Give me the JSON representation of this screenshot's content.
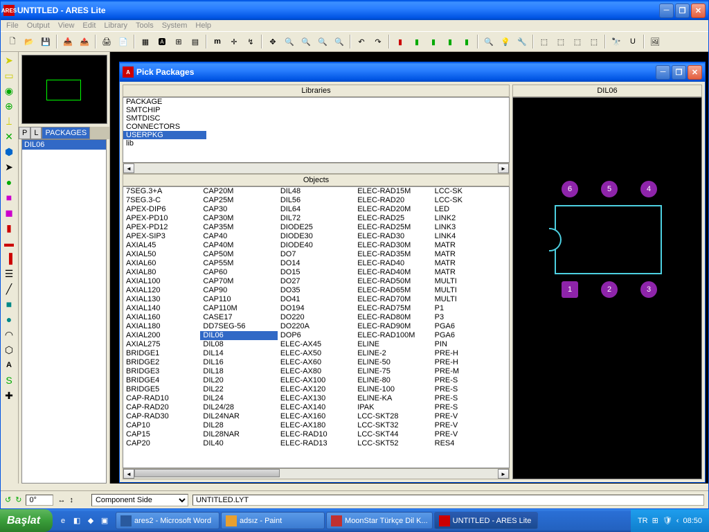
{
  "window": {
    "title": "UNTITLED - ARES Lite",
    "icon_text": "ARES"
  },
  "menu": [
    "File",
    "Output",
    "View",
    "Edit",
    "Library",
    "Tools",
    "System",
    "Help"
  ],
  "left_panel": {
    "tabs": [
      "P",
      "L",
      "PACKAGES"
    ],
    "items": [
      "DIL06"
    ]
  },
  "dialog": {
    "title": "Pick Packages",
    "libraries_header": "Libraries",
    "objects_header": "Objects",
    "preview_header": "DIL06",
    "libraries": [
      "PACKAGE",
      "SMTCHIP",
      "SMTDISC",
      "CONNECTORS",
      "USERPKG",
      "lib"
    ],
    "selected_library": "USERPKG",
    "selected_object": "DIL06",
    "columns": [
      [
        "7SEG.3+A",
        "7SEG.3-C",
        "APEX-DIP6",
        "APEX-PD10",
        "APEX-PD12",
        "APEX-SIP3",
        "AXIAL45",
        "AXIAL50",
        "AXIAL60",
        "AXIAL80",
        "AXIAL100",
        "AXIAL120",
        "AXIAL130",
        "AXIAL140",
        "AXIAL160",
        "AXIAL180",
        "AXIAL200",
        "AXIAL275",
        "BRIDGE1",
        "BRIDGE2",
        "BRIDGE3",
        "BRIDGE4",
        "BRIDGE5",
        "CAP-RAD10",
        "CAP-RAD20",
        "CAP-RAD30",
        "CAP10",
        "CAP15",
        "CAP20"
      ],
      [
        "CAP20M",
        "CAP25M",
        "CAP30",
        "CAP30M",
        "CAP35M",
        "CAP40",
        "CAP40M",
        "CAP50M",
        "CAP55M",
        "CAP60",
        "CAP70M",
        "CAP90",
        "CAP110",
        "CAP110M",
        "CASE17",
        "DD7SEG-56",
        "DIL06",
        "DIL08",
        "DIL14",
        "DIL16",
        "DIL18",
        "DIL20",
        "DIL22",
        "DIL24",
        "DIL24/28",
        "DIL24NAR",
        "DIL28",
        "DIL28NAR",
        "DIL40"
      ],
      [
        "DIL48",
        "DIL56",
        "DIL64",
        "DIL72",
        "DIODE25",
        "DIODE30",
        "DIODE40",
        "DO7",
        "DO14",
        "DO15",
        "DO27",
        "DO35",
        "DO41",
        "DO194",
        "DO220",
        "DO220A",
        "DOP6",
        "ELEC-AX45",
        "ELEC-AX50",
        "ELEC-AX60",
        "ELEC-AX80",
        "ELEC-AX100",
        "ELEC-AX120",
        "ELEC-AX130",
        "ELEC-AX140",
        "ELEC-AX160",
        "ELEC-AX180",
        "ELEC-RAD10",
        "ELEC-RAD13"
      ],
      [
        "ELEC-RAD15M",
        "ELEC-RAD20",
        "ELEC-RAD20M",
        "ELEC-RAD25",
        "ELEC-RAD25M",
        "ELEC-RAD30",
        "ELEC-RAD30M",
        "ELEC-RAD35M",
        "ELEC-RAD40",
        "ELEC-RAD40M",
        "ELEC-RAD50M",
        "ELEC-RAD65M",
        "ELEC-RAD70M",
        "ELEC-RAD75M",
        "ELEC-RAD80M",
        "ELEC-RAD90M",
        "ELEC-RAD100M",
        "ELINE",
        "ELINE-2",
        "ELINE-50",
        "ELINE-75",
        "ELINE-80",
        "ELINE-100",
        "ELINE-KA",
        "IPAK",
        "LCC-SKT28",
        "LCC-SKT32",
        "LCC-SKT44",
        "LCC-SKT52"
      ],
      [
        "LCC-SK",
        "LCC-SK",
        "LED",
        "LINK2",
        "LINK3",
        "LINK4",
        "MATR",
        "MATR",
        "MATR",
        "MATR",
        "MULTI",
        "MULTI",
        "MULTI",
        "P1",
        "P3",
        "PGA6",
        "PGA6",
        "PIN",
        "PRE-H",
        "PRE-H",
        "PRE-M",
        "PRE-S",
        "PRE-S",
        "PRE-S",
        "PRE-S",
        "PRE-V",
        "PRE-V",
        "PRE-V",
        "RES4"
      ]
    ],
    "pads": [
      "6",
      "5",
      "4",
      "1",
      "2",
      "3"
    ]
  },
  "statusbar": {
    "rotation": "0°",
    "layer": "Component Side",
    "file": "UNTITLED.LYT"
  },
  "taskbar": {
    "start": "Başlat",
    "tasks": [
      {
        "label": "ares2 - Microsoft Word"
      },
      {
        "label": "adsız - Paint"
      },
      {
        "label": "MoonStar Türkçe Dil K..."
      },
      {
        "label": "UNTITLED - ARES Lite"
      }
    ],
    "lang": "TR",
    "time": "08:50"
  }
}
